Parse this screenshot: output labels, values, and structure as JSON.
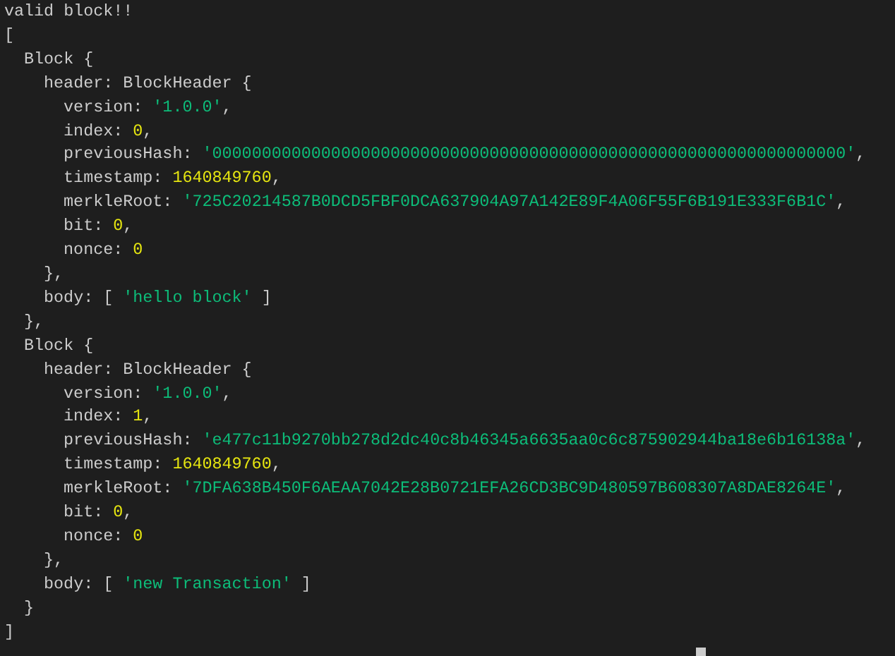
{
  "terminal": {
    "lines": [
      {
        "tokens": [
          {
            "kind": "plain",
            "text": "valid block!!"
          }
        ]
      },
      {
        "tokens": [
          {
            "kind": "plain",
            "text": "["
          }
        ],
        "children": [
          {
            "tokens": [
              {
                "kind": "plain",
                "text": "Block {"
              }
            ],
            "children": [
              {
                "tokens": [
                  {
                    "kind": "plain",
                    "text": "header: BlockHeader {"
                  }
                ],
                "children": [
                  {
                    "tokens": [
                      {
                        "kind": "plain",
                        "text": "version: "
                      },
                      {
                        "kind": "string",
                        "text": "'1.0.0'"
                      },
                      {
                        "kind": "plain",
                        "text": ","
                      }
                    ]
                  },
                  {
                    "tokens": [
                      {
                        "kind": "plain",
                        "text": "index: "
                      },
                      {
                        "kind": "number",
                        "text": "0"
                      },
                      {
                        "kind": "plain",
                        "text": ","
                      }
                    ]
                  },
                  {
                    "tokens": [
                      {
                        "kind": "plain",
                        "text": "previousHash: "
                      },
                      {
                        "kind": "string",
                        "text": "'0000000000000000000000000000000000000000000000000000000000000000'"
                      },
                      {
                        "kind": "plain",
                        "text": ","
                      }
                    ]
                  },
                  {
                    "tokens": [
                      {
                        "kind": "plain",
                        "text": "timestamp: "
                      },
                      {
                        "kind": "number",
                        "text": "1640849760"
                      },
                      {
                        "kind": "plain",
                        "text": ","
                      }
                    ]
                  },
                  {
                    "tokens": [
                      {
                        "kind": "plain",
                        "text": "merkleRoot: "
                      },
                      {
                        "kind": "string",
                        "text": "'725C20214587B0DCD5FBF0DCA637904A97A142E89F4A06F55F6B191E333F6B1C'"
                      },
                      {
                        "kind": "plain",
                        "text": ","
                      }
                    ]
                  },
                  {
                    "tokens": [
                      {
                        "kind": "plain",
                        "text": "bit: "
                      },
                      {
                        "kind": "number",
                        "text": "0"
                      },
                      {
                        "kind": "plain",
                        "text": ","
                      }
                    ]
                  },
                  {
                    "tokens": [
                      {
                        "kind": "plain",
                        "text": "nonce: "
                      },
                      {
                        "kind": "number",
                        "text": "0"
                      }
                    ]
                  }
                ]
              },
              {
                "tokens": [
                  {
                    "kind": "plain",
                    "text": "},"
                  }
                ]
              },
              {
                "tokens": [
                  {
                    "kind": "plain",
                    "text": "body: [ "
                  },
                  {
                    "kind": "string",
                    "text": "'hello block'"
                  },
                  {
                    "kind": "plain",
                    "text": " ]"
                  }
                ]
              }
            ]
          },
          {
            "tokens": [
              {
                "kind": "plain",
                "text": "},"
              }
            ]
          },
          {
            "tokens": [
              {
                "kind": "plain",
                "text": "Block {"
              }
            ],
            "children": [
              {
                "tokens": [
                  {
                    "kind": "plain",
                    "text": "header: BlockHeader {"
                  }
                ],
                "children": [
                  {
                    "tokens": [
                      {
                        "kind": "plain",
                        "text": "version: "
                      },
                      {
                        "kind": "string",
                        "text": "'1.0.0'"
                      },
                      {
                        "kind": "plain",
                        "text": ","
                      }
                    ]
                  },
                  {
                    "tokens": [
                      {
                        "kind": "plain",
                        "text": "index: "
                      },
                      {
                        "kind": "number",
                        "text": "1"
                      },
                      {
                        "kind": "plain",
                        "text": ","
                      }
                    ]
                  },
                  {
                    "tokens": [
                      {
                        "kind": "plain",
                        "text": "previousHash: "
                      },
                      {
                        "kind": "string",
                        "text": "'e477c11b9270bb278d2dc40c8b46345a6635aa0c6c875902944ba18e6b16138a'"
                      },
                      {
                        "kind": "plain",
                        "text": ","
                      }
                    ]
                  },
                  {
                    "tokens": [
                      {
                        "kind": "plain",
                        "text": "timestamp: "
                      },
                      {
                        "kind": "number",
                        "text": "1640849760"
                      },
                      {
                        "kind": "plain",
                        "text": ","
                      }
                    ]
                  },
                  {
                    "tokens": [
                      {
                        "kind": "plain",
                        "text": "merkleRoot: "
                      },
                      {
                        "kind": "string",
                        "text": "'7DFA638B450F6AEAA7042E28B0721EFA26CD3BC9D480597B608307A8DAE8264E'"
                      },
                      {
                        "kind": "plain",
                        "text": ","
                      }
                    ]
                  },
                  {
                    "tokens": [
                      {
                        "kind": "plain",
                        "text": "bit: "
                      },
                      {
                        "kind": "number",
                        "text": "0"
                      },
                      {
                        "kind": "plain",
                        "text": ","
                      }
                    ]
                  },
                  {
                    "tokens": [
                      {
                        "kind": "plain",
                        "text": "nonce: "
                      },
                      {
                        "kind": "number",
                        "text": "0"
                      }
                    ]
                  }
                ]
              },
              {
                "tokens": [
                  {
                    "kind": "plain",
                    "text": "},"
                  }
                ]
              },
              {
                "tokens": [
                  {
                    "kind": "plain",
                    "text": "body: [ "
                  },
                  {
                    "kind": "string",
                    "text": "'new Transaction'"
                  },
                  {
                    "kind": "plain",
                    "text": " ]"
                  }
                ]
              }
            ]
          },
          {
            "tokens": [
              {
                "kind": "plain",
                "text": "}"
              }
            ]
          }
        ]
      },
      {
        "tokens": [
          {
            "kind": "plain",
            "text": "]"
          }
        ]
      }
    ]
  }
}
